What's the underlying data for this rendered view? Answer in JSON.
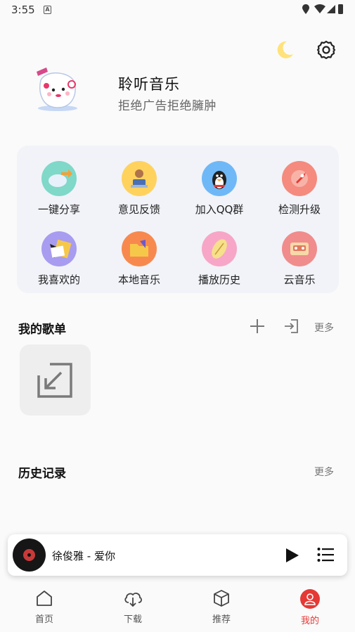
{
  "status_bar": {
    "time": "3:55",
    "sim_label": "A"
  },
  "header": {
    "moon_icon": "moon-icon",
    "settings_icon": "gear-icon"
  },
  "profile": {
    "title": "聆听音乐",
    "subtitle": "拒绝广告拒绝臃肿"
  },
  "functions": [
    {
      "label": "一键分享",
      "color": "#7fd8c8"
    },
    {
      "label": "意见反馈",
      "color": "#ffd25e"
    },
    {
      "label": "加入QQ群",
      "color": "#6fb8f7"
    },
    {
      "label": "检测升级",
      "color": "#f58a7e"
    },
    {
      "label": "我喜欢的",
      "color": "#a79cf0"
    },
    {
      "label": "本地音乐",
      "color": "#f8894e"
    },
    {
      "label": "播放历史",
      "color": "#f7a6c8"
    },
    {
      "label": "云音乐",
      "color": "#f08c8c"
    }
  ],
  "playlists": {
    "title": "我的歌单",
    "more": "更多"
  },
  "history": {
    "title": "历史记录",
    "more": "更多"
  },
  "player": {
    "song": "徐俊雅 - 爱你"
  },
  "nav": [
    {
      "label": "首页",
      "icon": "home-icon"
    },
    {
      "label": "下载",
      "icon": "cloud-download-icon"
    },
    {
      "label": "推荐",
      "icon": "cube-icon"
    },
    {
      "label": "我的",
      "icon": "user-icon",
      "active": true
    }
  ],
  "colors": {
    "accent": "#e53935",
    "card_bg": "#f1f3f8"
  }
}
